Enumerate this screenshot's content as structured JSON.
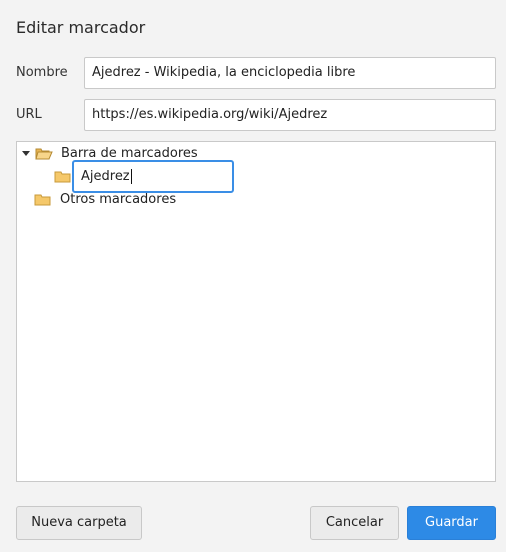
{
  "dialog": {
    "title": "Editar marcador"
  },
  "form": {
    "name_label": "Nombre",
    "name_value": "Ajedrez - Wikipedia, la enciclopedia libre",
    "url_label": "URL",
    "url_value": "https://es.wikipedia.org/wiki/Ajedrez"
  },
  "tree": {
    "root": {
      "label": "Barra de marcadores",
      "expanded": true,
      "icon": "folder-open-icon"
    },
    "new_folder_edit_value": "Ajedrez",
    "other": {
      "label": "Otros marcadores",
      "icon": "folder-icon"
    }
  },
  "buttons": {
    "new_folder": "Nueva carpeta",
    "cancel": "Cancelar",
    "save": "Guardar"
  },
  "colors": {
    "accent": "#2d8ae6",
    "folder": "#f5c86a",
    "folder_border": "#c89a3a"
  }
}
